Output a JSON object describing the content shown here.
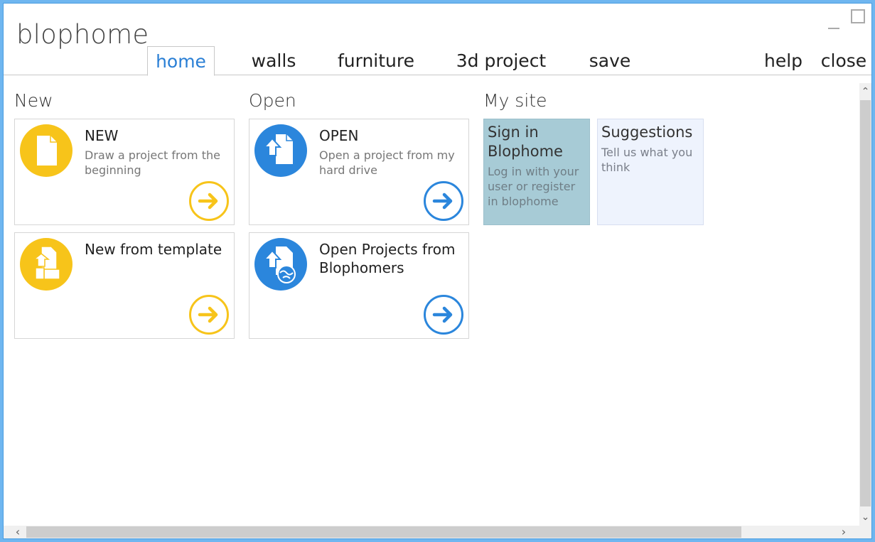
{
  "app": {
    "title": "blophome"
  },
  "tabs": [
    {
      "label": "home",
      "active": true
    },
    {
      "label": "walls"
    },
    {
      "label": "furniture"
    },
    {
      "label": "3d project"
    },
    {
      "label": "save"
    }
  ],
  "header_actions": {
    "help": "help",
    "close": "close"
  },
  "sections": {
    "new": {
      "title": "New",
      "cards": [
        {
          "title": "NEW",
          "description": "Draw a project from the beginning",
          "icon": "document-icon"
        },
        {
          "title": "New from template",
          "description": "",
          "icon": "template-icon"
        }
      ]
    },
    "open": {
      "title": "Open",
      "cards": [
        {
          "title": "OPEN",
          "description": "Open a project from my hard drive",
          "icon": "upload-document-icon"
        },
        {
          "title": "Open Projects from Blophomers",
          "description": "",
          "icon": "upload-globe-icon"
        }
      ]
    },
    "my_site": {
      "title": "My site",
      "tiles": [
        {
          "title": "Sign in Blophome",
          "description": "Log in with your user or register in blophome"
        },
        {
          "title": "Suggestions",
          "description": "Tell us what you think"
        }
      ]
    }
  },
  "colors": {
    "yellow": "#f7c41a",
    "blue": "#2b86dc",
    "accent_tab": "#2a7fd5",
    "signin_tile": "#a7cbd6",
    "suggestions_tile": "#eef3fd"
  }
}
